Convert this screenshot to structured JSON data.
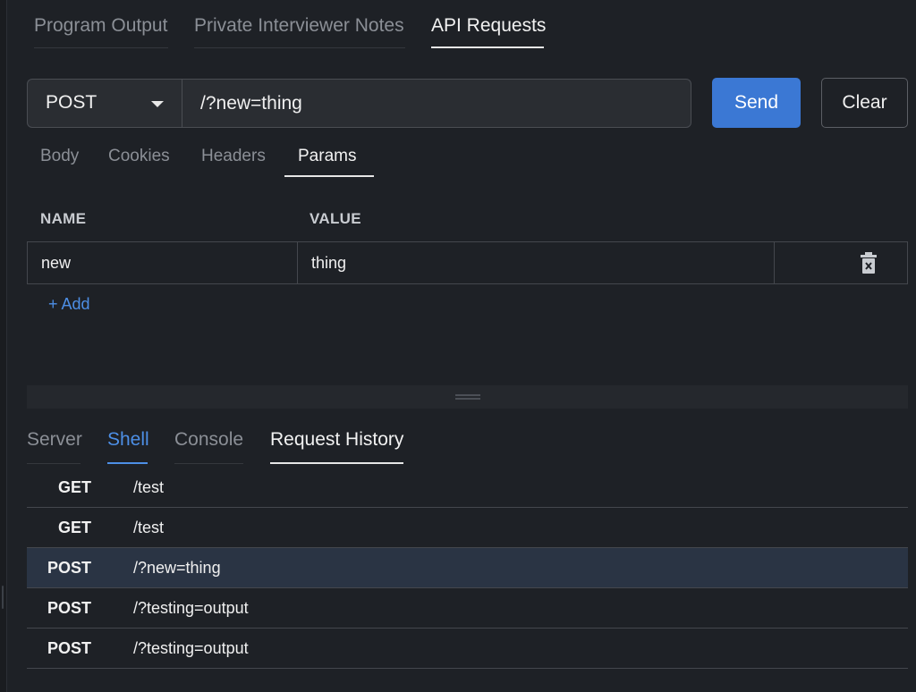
{
  "top_tabs": [
    {
      "label": "Program Output",
      "active": false
    },
    {
      "label": "Private Interviewer Notes",
      "active": false
    },
    {
      "label": "API Requests",
      "active": true
    }
  ],
  "request": {
    "method": "POST",
    "url": "/?new=thing",
    "send_label": "Send",
    "clear_label": "Clear"
  },
  "sub_tabs": [
    {
      "label": "Body"
    },
    {
      "label": "Cookies"
    },
    {
      "label": "Headers"
    },
    {
      "label": "Params",
      "active": true
    }
  ],
  "params": {
    "columns": [
      "NAME",
      "VALUE"
    ],
    "rows": [
      {
        "name": "new",
        "value": "thing"
      }
    ],
    "add_label": "+ Add"
  },
  "bottom_tabs": [
    {
      "label": "Server"
    },
    {
      "label": "Shell",
      "highlight": true
    },
    {
      "label": "Console"
    },
    {
      "label": "Request History",
      "active": true
    }
  ],
  "history": [
    {
      "method": "GET",
      "path": "/test",
      "selected": false
    },
    {
      "method": "GET",
      "path": "/test",
      "selected": false
    },
    {
      "method": "POST",
      "path": "/?new=thing",
      "selected": true
    },
    {
      "method": "POST",
      "path": "/?testing=output",
      "selected": false
    },
    {
      "method": "POST",
      "path": "/?testing=output",
      "selected": false
    }
  ],
  "colors": {
    "accent": "#3b78d4",
    "link": "#4d8fe6",
    "background": "#1e2126",
    "selected_row": "#2a3444"
  }
}
